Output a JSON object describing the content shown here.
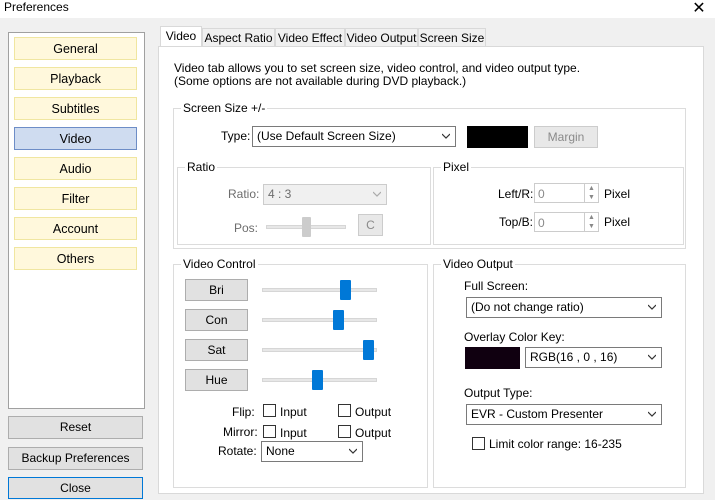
{
  "window": {
    "title": "Preferences"
  },
  "sidebar": {
    "items": [
      {
        "label": "General"
      },
      {
        "label": "Playback"
      },
      {
        "label": "Subtitles"
      },
      {
        "label": "Video"
      },
      {
        "label": "Audio"
      },
      {
        "label": "Filter"
      },
      {
        "label": "Account"
      },
      {
        "label": "Others"
      }
    ],
    "active": "Video"
  },
  "footer": {
    "reset": "Reset",
    "backup": "Backup Preferences",
    "close": "Close"
  },
  "tabs": [
    "Video",
    "Aspect Ratio",
    "Video Effect",
    "Video Output",
    "Screen Size"
  ],
  "video": {
    "description_line1": "Video tab allows you to set screen size, video control, and video output type.",
    "description_line2": "(Some options are not available during DVD playback.)",
    "screen_size": {
      "group_label": "Screen Size +/-",
      "type_label": "Type:",
      "type_value": "(Use Default Screen Size)",
      "color": "#000000",
      "margin_label": "Margin"
    },
    "ratio": {
      "group_label": "Ratio",
      "ratio_label": "Ratio:",
      "ratio_value": "4 : 3",
      "pos_label": "Pos:",
      "c_label": "C",
      "pos_level": 0.5
    },
    "pixel": {
      "group_label": "Pixel",
      "left_label": "Left/R:",
      "left_value": "0",
      "top_label": "Top/B:",
      "top_value": "0",
      "unit": "Pixel"
    },
    "video_control": {
      "group_label": "Video Control",
      "buttons": [
        "Bri",
        "Con",
        "Sat",
        "Hue"
      ],
      "levels": [
        0.75,
        0.68,
        0.97,
        0.48
      ],
      "flip_label": "Flip:",
      "mirror_label": "Mirror:",
      "input_label": "Input",
      "output_label": "Output",
      "rotate_label": "Rotate:",
      "rotate_value": "None"
    },
    "video_output": {
      "group_label": "Video Output",
      "full_screen_label": "Full Screen:",
      "full_screen_value": "(Do not change ratio)",
      "overlay_label": "Overlay Color Key:",
      "overlay_color": "#100010",
      "overlay_value": "RGB(16 , 0 , 16)",
      "output_type_label": "Output Type:",
      "output_type_value": "EVR - Custom Presenter",
      "limit_label": "Limit color range: 16-235"
    }
  }
}
